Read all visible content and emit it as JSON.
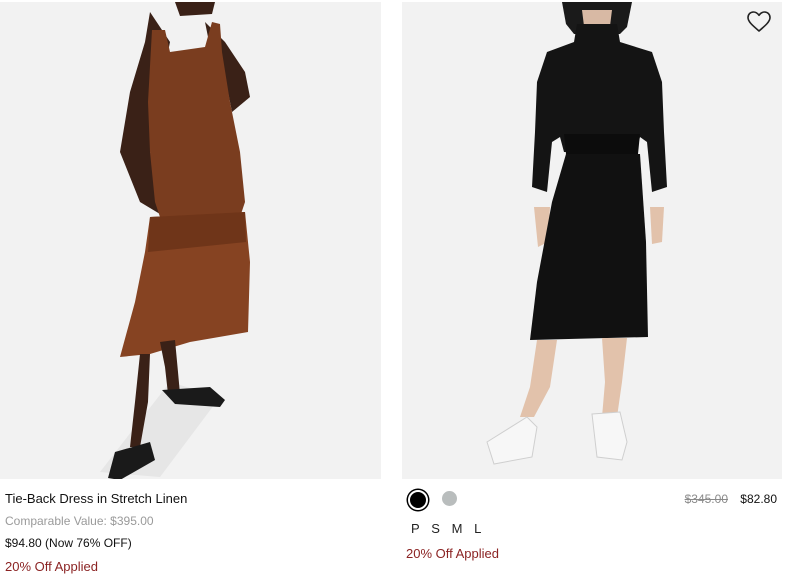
{
  "products": [
    {
      "name": "Tie-Back Dress in Stretch Linen",
      "comparable_value": "Comparable Value: $395.00",
      "price_now": "$94.80 (Now 76% OFF)",
      "promo": "20% Off Applied",
      "image_icon": "brown-linen-dress-photo"
    },
    {
      "original_price": "$345.00",
      "sale_price": "$82.80",
      "promo": "20% Off Applied",
      "swatches": [
        {
          "name": "black",
          "color": "#000000",
          "selected": true
        },
        {
          "name": "grey",
          "color": "#b9bdbd",
          "selected": false
        }
      ],
      "sizes": [
        "P",
        "S",
        "M",
        "L"
      ],
      "wishlist_icon": "heart-outline-icon",
      "image_icon": "black-knit-dress-photo"
    }
  ],
  "colors": {
    "promo": "#8b2323",
    "image_bg": "#f2f2f2",
    "dress_brown": "#7a3d1f",
    "dress_black": "#111111"
  }
}
